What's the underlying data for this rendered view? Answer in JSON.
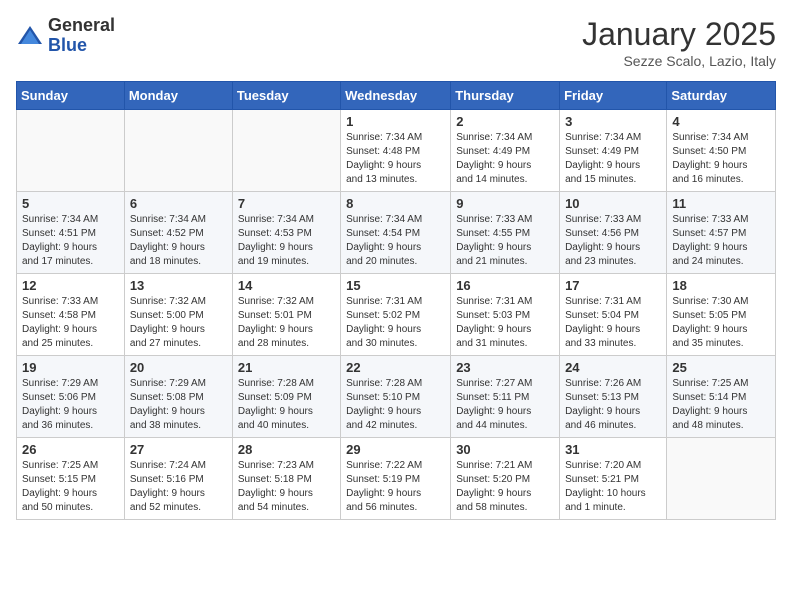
{
  "header": {
    "logo_general": "General",
    "logo_blue": "Blue",
    "month": "January 2025",
    "location": "Sezze Scalo, Lazio, Italy"
  },
  "weekdays": [
    "Sunday",
    "Monday",
    "Tuesday",
    "Wednesday",
    "Thursday",
    "Friday",
    "Saturday"
  ],
  "weeks": [
    [
      {
        "day": "",
        "info": ""
      },
      {
        "day": "",
        "info": ""
      },
      {
        "day": "",
        "info": ""
      },
      {
        "day": "1",
        "info": "Sunrise: 7:34 AM\nSunset: 4:48 PM\nDaylight: 9 hours\nand 13 minutes."
      },
      {
        "day": "2",
        "info": "Sunrise: 7:34 AM\nSunset: 4:49 PM\nDaylight: 9 hours\nand 14 minutes."
      },
      {
        "day": "3",
        "info": "Sunrise: 7:34 AM\nSunset: 4:49 PM\nDaylight: 9 hours\nand 15 minutes."
      },
      {
        "day": "4",
        "info": "Sunrise: 7:34 AM\nSunset: 4:50 PM\nDaylight: 9 hours\nand 16 minutes."
      }
    ],
    [
      {
        "day": "5",
        "info": "Sunrise: 7:34 AM\nSunset: 4:51 PM\nDaylight: 9 hours\nand 17 minutes."
      },
      {
        "day": "6",
        "info": "Sunrise: 7:34 AM\nSunset: 4:52 PM\nDaylight: 9 hours\nand 18 minutes."
      },
      {
        "day": "7",
        "info": "Sunrise: 7:34 AM\nSunset: 4:53 PM\nDaylight: 9 hours\nand 19 minutes."
      },
      {
        "day": "8",
        "info": "Sunrise: 7:34 AM\nSunset: 4:54 PM\nDaylight: 9 hours\nand 20 minutes."
      },
      {
        "day": "9",
        "info": "Sunrise: 7:33 AM\nSunset: 4:55 PM\nDaylight: 9 hours\nand 21 minutes."
      },
      {
        "day": "10",
        "info": "Sunrise: 7:33 AM\nSunset: 4:56 PM\nDaylight: 9 hours\nand 23 minutes."
      },
      {
        "day": "11",
        "info": "Sunrise: 7:33 AM\nSunset: 4:57 PM\nDaylight: 9 hours\nand 24 minutes."
      }
    ],
    [
      {
        "day": "12",
        "info": "Sunrise: 7:33 AM\nSunset: 4:58 PM\nDaylight: 9 hours\nand 25 minutes."
      },
      {
        "day": "13",
        "info": "Sunrise: 7:32 AM\nSunset: 5:00 PM\nDaylight: 9 hours\nand 27 minutes."
      },
      {
        "day": "14",
        "info": "Sunrise: 7:32 AM\nSunset: 5:01 PM\nDaylight: 9 hours\nand 28 minutes."
      },
      {
        "day": "15",
        "info": "Sunrise: 7:31 AM\nSunset: 5:02 PM\nDaylight: 9 hours\nand 30 minutes."
      },
      {
        "day": "16",
        "info": "Sunrise: 7:31 AM\nSunset: 5:03 PM\nDaylight: 9 hours\nand 31 minutes."
      },
      {
        "day": "17",
        "info": "Sunrise: 7:31 AM\nSunset: 5:04 PM\nDaylight: 9 hours\nand 33 minutes."
      },
      {
        "day": "18",
        "info": "Sunrise: 7:30 AM\nSunset: 5:05 PM\nDaylight: 9 hours\nand 35 minutes."
      }
    ],
    [
      {
        "day": "19",
        "info": "Sunrise: 7:29 AM\nSunset: 5:06 PM\nDaylight: 9 hours\nand 36 minutes."
      },
      {
        "day": "20",
        "info": "Sunrise: 7:29 AM\nSunset: 5:08 PM\nDaylight: 9 hours\nand 38 minutes."
      },
      {
        "day": "21",
        "info": "Sunrise: 7:28 AM\nSunset: 5:09 PM\nDaylight: 9 hours\nand 40 minutes."
      },
      {
        "day": "22",
        "info": "Sunrise: 7:28 AM\nSunset: 5:10 PM\nDaylight: 9 hours\nand 42 minutes."
      },
      {
        "day": "23",
        "info": "Sunrise: 7:27 AM\nSunset: 5:11 PM\nDaylight: 9 hours\nand 44 minutes."
      },
      {
        "day": "24",
        "info": "Sunrise: 7:26 AM\nSunset: 5:13 PM\nDaylight: 9 hours\nand 46 minutes."
      },
      {
        "day": "25",
        "info": "Sunrise: 7:25 AM\nSunset: 5:14 PM\nDaylight: 9 hours\nand 48 minutes."
      }
    ],
    [
      {
        "day": "26",
        "info": "Sunrise: 7:25 AM\nSunset: 5:15 PM\nDaylight: 9 hours\nand 50 minutes."
      },
      {
        "day": "27",
        "info": "Sunrise: 7:24 AM\nSunset: 5:16 PM\nDaylight: 9 hours\nand 52 minutes."
      },
      {
        "day": "28",
        "info": "Sunrise: 7:23 AM\nSunset: 5:18 PM\nDaylight: 9 hours\nand 54 minutes."
      },
      {
        "day": "29",
        "info": "Sunrise: 7:22 AM\nSunset: 5:19 PM\nDaylight: 9 hours\nand 56 minutes."
      },
      {
        "day": "30",
        "info": "Sunrise: 7:21 AM\nSunset: 5:20 PM\nDaylight: 9 hours\nand 58 minutes."
      },
      {
        "day": "31",
        "info": "Sunrise: 7:20 AM\nSunset: 5:21 PM\nDaylight: 10 hours\nand 1 minute."
      },
      {
        "day": "",
        "info": ""
      }
    ]
  ]
}
